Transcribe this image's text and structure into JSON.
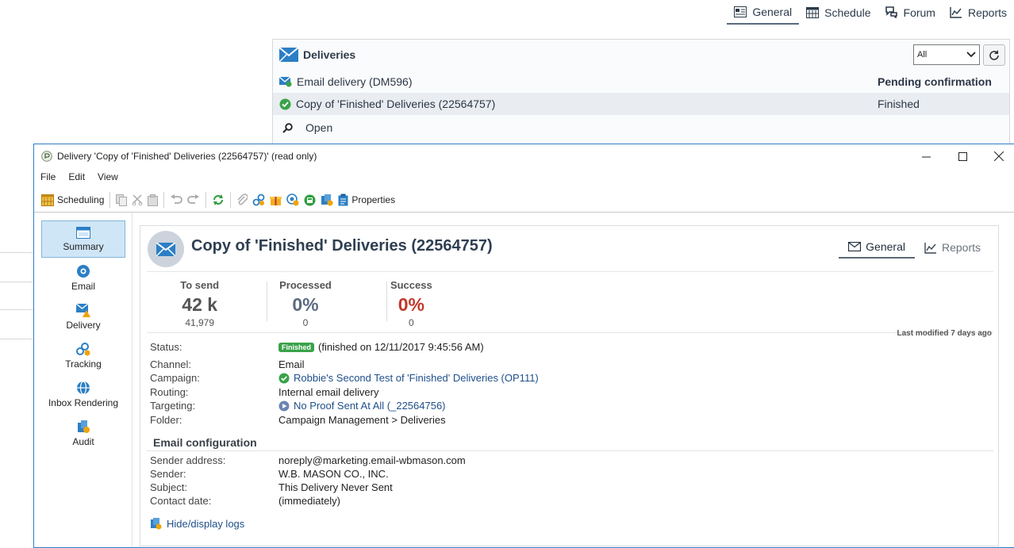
{
  "top_nav": {
    "tabs": [
      {
        "label": "General",
        "icon": "general-icon",
        "active": true
      },
      {
        "label": "Schedule",
        "icon": "calendar-icon"
      },
      {
        "label": "Forum",
        "icon": "forum-icon"
      },
      {
        "label": "Reports",
        "icon": "reports-chart-icon"
      }
    ]
  },
  "deliveries_panel": {
    "title": "Deliveries",
    "filter_value": "All",
    "rows": [
      {
        "name": "Email delivery (DM596)",
        "status": "Pending confirmation"
      },
      {
        "name": "Copy of 'Finished' Deliveries (22564757)",
        "status": "Finished"
      }
    ],
    "open_label": "Open"
  },
  "window": {
    "title": "Delivery 'Copy of 'Finished' Deliveries (22564757)' (read only)",
    "menu": [
      "File",
      "Edit",
      "View"
    ],
    "toolbar": {
      "scheduling": "Scheduling",
      "properties": "Properties"
    },
    "sidenav": [
      {
        "label": "Summary",
        "icon": "summary-icon",
        "active": true
      },
      {
        "label": "Email",
        "icon": "email-icon"
      },
      {
        "label": "Delivery",
        "icon": "delivery-icon"
      },
      {
        "label": "Tracking",
        "icon": "tracking-icon"
      },
      {
        "label": "Inbox Rendering",
        "icon": "globe-icon"
      },
      {
        "label": "Audit",
        "icon": "audit-icon"
      }
    ]
  },
  "summary": {
    "title": "Copy of 'Finished' Deliveries (22564757)",
    "tabs": [
      {
        "label": "General",
        "active": true
      },
      {
        "label": "Reports"
      }
    ],
    "stats": [
      {
        "label": "To send",
        "value": "42 k",
        "sub": "41,979",
        "color": "#555555"
      },
      {
        "label": "Processed",
        "value": "0%",
        "sub": "0",
        "color": "#5b6b80"
      },
      {
        "label": "Success",
        "value": "0%",
        "sub": "0",
        "color": "#c0392b"
      }
    ],
    "status_label": "Status:",
    "status_badge": "Finished",
    "status_text": "(finished on 12/11/2017 9:45:56 AM)",
    "last_modified": "Last modified 7 days ago",
    "fields": [
      {
        "label": "Channel:",
        "value": "Email"
      },
      {
        "label": "Campaign:",
        "value": "Robbie's Second Test of 'Finished' Deliveries (OP111)"
      },
      {
        "label": "Routing:",
        "value": "Internal email delivery"
      },
      {
        "label": "Targeting:",
        "value": "No Proof Sent At All (_22564756)"
      },
      {
        "label": "Folder:",
        "value": "Campaign Management > Deliveries"
      }
    ],
    "email_config_title": "Email configuration",
    "email_fields": [
      {
        "label": "Sender address:",
        "value": "noreply@marketing.email-wbmason.com"
      },
      {
        "label": "Sender:",
        "value": "W.B. MASON CO., INC."
      },
      {
        "label": "Subject:",
        "value": "This Delivery Never Sent"
      },
      {
        "label": "Contact date:",
        "value": "(immediately)"
      }
    ],
    "hide_logs": "Hide/display logs"
  }
}
